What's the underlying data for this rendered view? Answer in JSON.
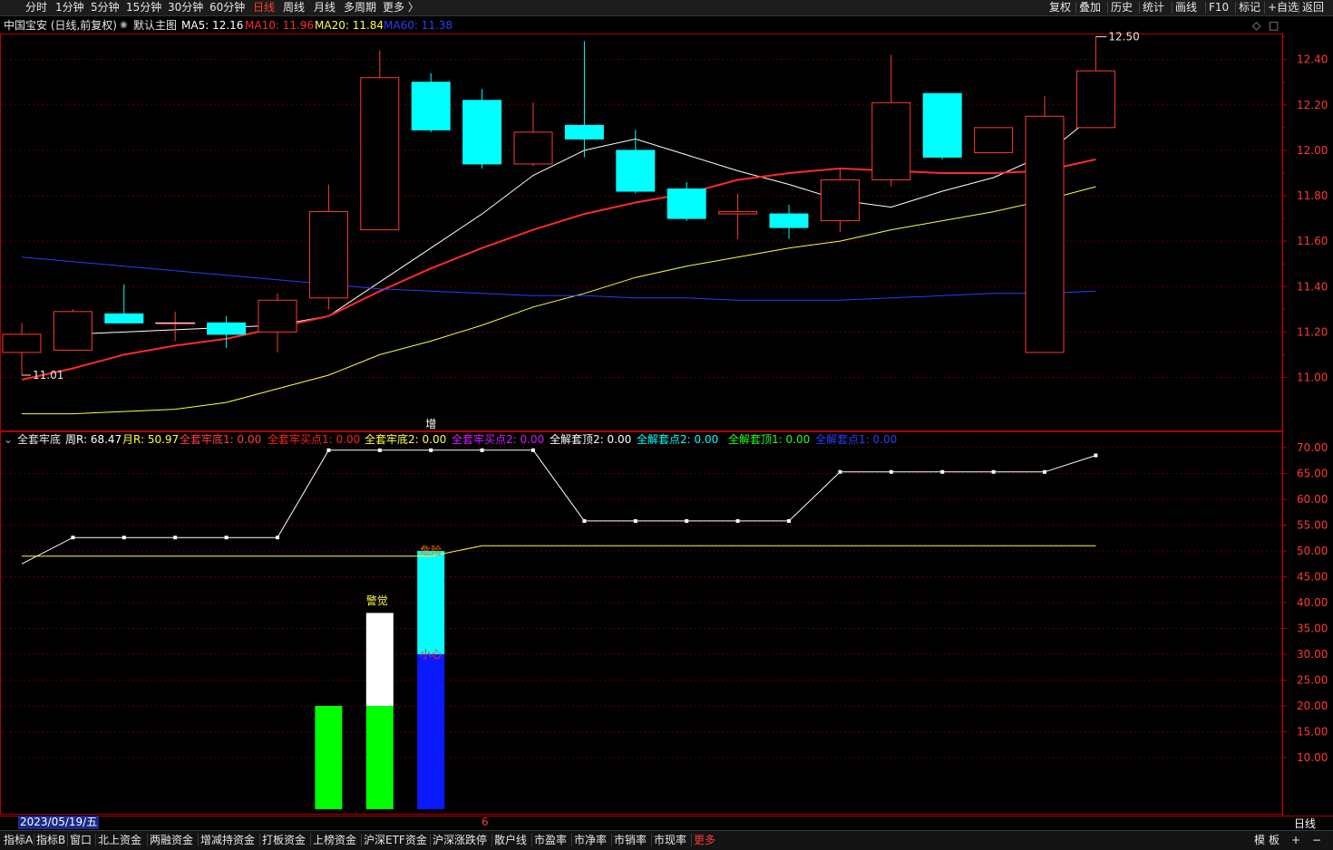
{
  "topbar": {
    "periods": [
      "分时",
      "1分钟",
      "5分钟",
      "15分钟",
      "30分钟",
      "60分钟",
      "日线",
      "周线",
      "月线",
      "多周期",
      "更多 〉"
    ],
    "active_period": "日线",
    "tools": [
      "复权",
      "叠加",
      "历史",
      "统计",
      "画线",
      "F10",
      "标记",
      "+自选",
      "返回"
    ]
  },
  "main_panel": {
    "title": "中国宝安 (日线,前复权)",
    "template": "默认主图",
    "ma_legend": [
      {
        "label": "MA5: 12.16",
        "color": "#ffffff"
      },
      {
        "label": "MA10: 11.96",
        "color": "#ff2a2a"
      },
      {
        "label": "MA20: 11.84",
        "color": "#ffff40"
      },
      {
        "label": "MA60: 11.38",
        "color": "#2a3cff"
      }
    ],
    "max_label": "12.50",
    "min_label": "11.01",
    "signal_label": "增"
  },
  "indicator_panel": {
    "name": "全套牢底",
    "legend": [
      {
        "label": "周R: 68.47",
        "color": "#ffffff"
      },
      {
        "label": "月R: 50.97",
        "color": "#ffff40"
      },
      {
        "label": "全套牢底1: 0.00",
        "color": "#ff4040"
      },
      {
        "label": "全套牢买点1: 0.00",
        "color": "#ff2020"
      },
      {
        "label": "全套牢底2: 0.00",
        "color": "#ffff40"
      },
      {
        "label": "全套牢买点2: 0.00",
        "color": "#d020ff"
      },
      {
        "label": "全解套顶2: 0.00",
        "color": "#ffffff"
      },
      {
        "label": "全解套点2: 0.00",
        "color": "#00ffff"
      },
      {
        "label": "全解套顶1: 0.00",
        "color": "#20ff20"
      },
      {
        "label": "全解套点1: 0.00",
        "color": "#2a3cff"
      }
    ],
    "annotations": {
      "warn": "警觉",
      "danger": "危险",
      "careful": "小心"
    }
  },
  "chart_data": [
    {
      "type": "candlestick",
      "title": "中国宝安 (日线,前复权)",
      "ylim": [
        10.88,
        12.58
      ],
      "y_ticks": [
        11.0,
        11.2,
        11.4,
        11.6,
        11.8,
        12.0,
        12.2,
        12.4
      ],
      "y_tick_labels": [
        "11.00",
        "11.20",
        "11.40",
        "11.60",
        "11.80",
        "12.00",
        "12.20",
        "12.40"
      ],
      "candles": [
        {
          "o": 11.11,
          "c": 11.19,
          "h": 11.24,
          "l": 11.01
        },
        {
          "o": 11.12,
          "c": 11.29,
          "h": 11.3,
          "l": 11.12
        },
        {
          "o": 11.28,
          "c": 11.24,
          "h": 11.41,
          "l": 11.24
        },
        {
          "o": 11.24,
          "c": 11.24,
          "h": 11.29,
          "l": 11.16
        },
        {
          "o": 11.24,
          "c": 11.19,
          "h": 11.27,
          "l": 11.13
        },
        {
          "o": 11.2,
          "c": 11.34,
          "h": 11.37,
          "l": 11.11
        },
        {
          "o": 11.35,
          "c": 11.73,
          "h": 11.85,
          "l": 11.3
        },
        {
          "o": 11.65,
          "c": 12.32,
          "h": 12.44,
          "l": 11.65
        },
        {
          "o": 12.3,
          "c": 12.09,
          "h": 12.34,
          "l": 12.08
        },
        {
          "o": 12.22,
          "c": 11.94,
          "h": 12.27,
          "l": 11.92
        },
        {
          "o": 11.94,
          "c": 12.08,
          "h": 12.21,
          "l": 11.93
        },
        {
          "o": 12.11,
          "c": 12.05,
          "h": 12.48,
          "l": 11.97
        },
        {
          "o": 12.0,
          "c": 11.82,
          "h": 12.09,
          "l": 11.81
        },
        {
          "o": 11.83,
          "c": 11.7,
          "h": 11.86,
          "l": 11.69
        },
        {
          "o": 11.72,
          "c": 11.73,
          "h": 11.81,
          "l": 11.61
        },
        {
          "o": 11.72,
          "c": 11.66,
          "h": 11.76,
          "l": 11.61
        },
        {
          "o": 11.69,
          "c": 11.87,
          "h": 11.92,
          "l": 11.64
        },
        {
          "o": 11.87,
          "c": 12.21,
          "h": 12.42,
          "l": 11.84
        },
        {
          "o": 12.25,
          "c": 11.97,
          "h": 12.25,
          "l": 11.96
        },
        {
          "o": 11.99,
          "c": 12.1,
          "h": 12.1,
          "l": 11.99
        },
        {
          "o": 11.11,
          "c": 12.15,
          "h": 12.24,
          "l": 12.05
        },
        {
          "o": 12.1,
          "c": 12.35,
          "h": 12.5,
          "l": 12.1
        }
      ],
      "series": [
        {
          "name": "MA5",
          "color": "#ffffff",
          "values": [
            null,
            11.19,
            11.2,
            11.21,
            11.22,
            11.23,
            11.27,
            11.42,
            11.57,
            11.72,
            11.89,
            12.0,
            12.05,
            11.98,
            11.91,
            11.85,
            11.78,
            11.75,
            11.82,
            11.88,
            11.98,
            12.16
          ]
        },
        {
          "name": "MA10",
          "color": "#ff2a2a",
          "values": [
            10.99,
            11.04,
            11.1,
            11.14,
            11.17,
            11.22,
            11.27,
            11.38,
            11.48,
            11.57,
            11.65,
            11.72,
            11.77,
            11.81,
            11.87,
            11.9,
            11.92,
            11.91,
            11.9,
            11.9,
            11.91,
            11.96
          ]
        },
        {
          "name": "MA20",
          "color": "#ffff40",
          "values": [
            10.84,
            10.84,
            10.85,
            10.86,
            10.89,
            10.95,
            11.01,
            11.1,
            11.16,
            11.23,
            11.31,
            11.37,
            11.44,
            11.49,
            11.53,
            11.57,
            11.6,
            11.65,
            11.69,
            11.73,
            11.78,
            11.84
          ]
        },
        {
          "name": "MA60",
          "color": "#2a3cff",
          "values": [
            11.53,
            11.51,
            11.49,
            11.47,
            11.45,
            11.43,
            11.41,
            11.39,
            11.38,
            11.37,
            11.36,
            11.36,
            11.35,
            11.35,
            11.34,
            11.34,
            11.34,
            11.35,
            11.36,
            11.37,
            11.37,
            11.38
          ]
        }
      ]
    },
    {
      "type": "line",
      "title": "全套牢底",
      "ylim": [
        0,
        72
      ],
      "y_ticks": [
        10,
        15,
        20,
        25,
        30,
        35,
        40,
        45,
        50,
        55,
        60,
        65,
        70
      ],
      "y_tick_labels": [
        "10.00",
        "15.00",
        "20.00",
        "25.00",
        "30.00",
        "35.00",
        "40.00",
        "45.00",
        "50.00",
        "55.00",
        "60.00",
        "65.00",
        "70.00"
      ],
      "series": [
        {
          "name": "周R",
          "color": "#ffffff",
          "values": [
            47.5,
            52.6,
            52.6,
            52.6,
            52.6,
            52.6,
            69.5,
            69.5,
            69.5,
            69.5,
            69.5,
            55.8,
            55.8,
            55.8,
            55.8,
            55.8,
            65.3,
            65.3,
            65.3,
            65.3,
            65.3,
            68.5
          ]
        },
        {
          "name": "月R",
          "color": "#ffff40",
          "values": [
            49.0,
            49.0,
            49.0,
            49.0,
            49.0,
            49.0,
            49.0,
            49.0,
            49.0,
            51.0,
            51.0,
            51.0,
            51.0,
            51.0,
            51.0,
            51.0,
            51.0,
            51.0,
            51.0,
            51.0,
            51.0,
            51.0
          ]
        }
      ],
      "bars": [
        {
          "index": 6,
          "from": 0,
          "to": 20,
          "color": "#00ff00"
        },
        {
          "index": 7,
          "from": 0,
          "to": 20,
          "color": "#00ff00"
        },
        {
          "index": 7,
          "from": 20,
          "to": 38,
          "color": "#ffffff"
        },
        {
          "index": 8,
          "from": 0,
          "to": 30,
          "color": "#0a1aff"
        },
        {
          "index": 8,
          "from": 30,
          "to": 50,
          "color": "#00ffff"
        }
      ]
    }
  ],
  "footer": {
    "date": "2023/05/19/五",
    "x_label": "6",
    "period": "日线",
    "tabs": [
      "指标A",
      "指标B",
      "窗口",
      "北上资金",
      "两融资金",
      "增减持资金",
      "打板资金",
      "上榜资金",
      "沪深ETF资金",
      "沪深涨跌停",
      "散户线",
      "市盈率",
      "市净率",
      "市销率",
      "市现率",
      "更多"
    ],
    "right_tools": [
      "模",
      "板",
      "+",
      "−"
    ]
  },
  "colors": {
    "up": "#ff3b30",
    "down": "#00ffff",
    "grid": "#5a0000",
    "axis": "#b00000"
  }
}
